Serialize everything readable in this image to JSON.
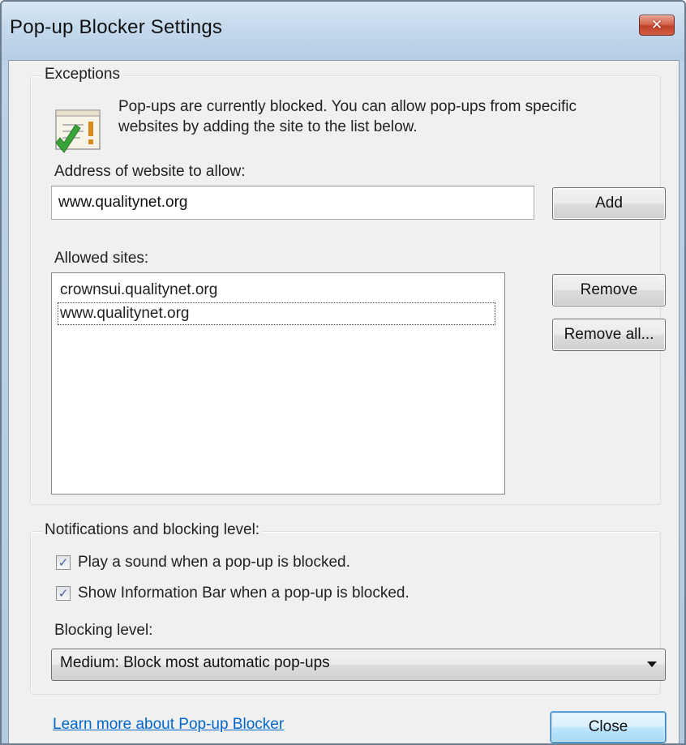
{
  "window": {
    "title": "Pop-up Blocker Settings",
    "close_glyph": "✕"
  },
  "exceptions": {
    "legend": "Exceptions",
    "info_text": "Pop-ups are currently blocked.  You can allow pop-ups from specific websites by adding the site to the list below.",
    "info_icon": "popup-blocked-check-icon",
    "address_label": "Address of website to allow:",
    "address_value": "www.qualitynet.org",
    "add_label": "Add",
    "allowed_label": "Allowed sites:",
    "allowed_sites": [
      "crownsui.qualitynet.org",
      "www.qualitynet.org"
    ],
    "remove_label": "Remove",
    "remove_all_label": "Remove all..."
  },
  "notifications": {
    "legend": "Notifications and blocking level:",
    "play_sound_label": "Play a sound when a pop-up is blocked.",
    "play_sound_checked": true,
    "info_bar_label": "Show Information Bar when a pop-up is blocked.",
    "info_bar_checked": true,
    "check_glyph": "✓",
    "blocking_level_label": "Blocking level:",
    "blocking_level_value": "Medium: Block most automatic pop-ups"
  },
  "footer": {
    "learn_more_link": "Learn more about Pop-up Blocker",
    "close_label": "Close"
  },
  "colors": {
    "link": "#0066cc",
    "check_green": "#39a33a",
    "close_red": "#c0402a"
  }
}
